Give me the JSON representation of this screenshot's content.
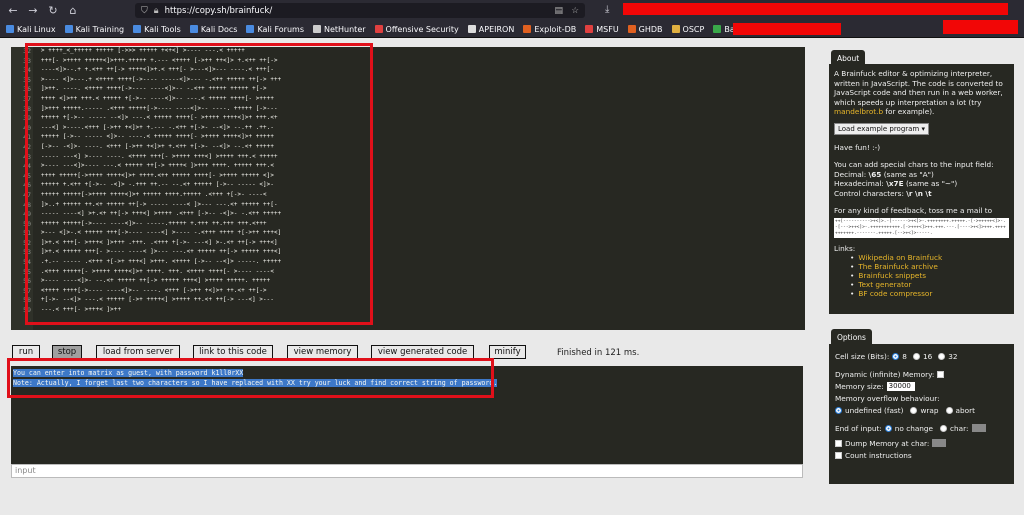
{
  "browser": {
    "url": "https://copy.sh/brainfuck/",
    "bookmarks": [
      "Kali Linux",
      "Kali Training",
      "Kali Tools",
      "Kali Docs",
      "Kali Forums",
      "NetHunter",
      "Offensive Security",
      "APEIRON",
      "Exploit-DB",
      "MSFU",
      "GHDB",
      "OSCP",
      "Base64 Decode and E..."
    ],
    "bookmark_colors": [
      "#4a8be0",
      "#4a8be0",
      "#4a8be0",
      "#4a8be0",
      "#4a8be0",
      "#cccccc",
      "#e04040",
      "#dddddd",
      "#e06020",
      "#e04040",
      "#e06020",
      "#e0b040",
      "#3aa84a"
    ]
  },
  "editor": {
    "line_numbers": [
      "32",
      "33",
      "34",
      "35",
      "36",
      "37",
      "38",
      "39",
      "40",
      "41",
      "42",
      "43",
      "44",
      "45",
      "46",
      "47",
      "48",
      "49",
      "50",
      "51",
      "52",
      "53",
      "54",
      "55",
      "56",
      "57",
      "58",
      "59"
    ],
    "code_lines": [
      "> ++++_<_+++++ +++++ [->>> +++++ +<+<] >---- ---.< +++++",
      "+++[- >++++ +++++<]>+++.+++++ +.--- <++++ [->++ ++<]> +.<++ ++[->",
      "----<]>--.+ +.<++ ++[-> ++++<]>+.< +++[- >---<]>--- ----.< +++[-",
      ">---- <]>---.+ <++++ ++++[->---- -----<]>--- -.<++ +++++ ++[-> +++",
      "]>++. ----. <++++ ++++[->---- ----<]>-- -.<++ +++++ +++++ +[->",
      "++++ <]>++ +++.< +++++ +[->-- ----<]>-- ---.< +++++ ++++[- >++++",
      "]>+++ +++++.----- .<+++ +++++[->---- ----<]>-- ----. +++++ [->---",
      "+++++ +[->-- ----- --<]> ---.< +++++ ++++[- >++++ ++++<]>+ +++.<+",
      "---<] >----.<+++ [->++ +<]>+ +.--- -.<++ +[->- --<]> --.++ .++.-",
      "+++++ [->-- ----- <]>-- ----.< +++++ ++++[- >++++ ++++<]>+ +++++",
      "[->-- -<]>- ----. <+++ [->++ +<]>+ +.<++ +[->- --<]> --.<+ +++++",
      "----- ---<] >---- ----. <++++ +++[- >++++ +++<] >++++ +++.< +++++",
      ">---- ---<]>---- ---.< +++++ ++[-> ++++< ]>+++ ++++. +++++ +++.<",
      "++++ +++++[->++++ ++++<]>+ ++++.<++ +++++ ++++[- >++++ +++++ <]>",
      "+++++ +.<++ +[->-- -<]> -.+++ ++.-- --.<+ +++++ [->-- ----- <]>-",
      "+++++ +++++[->++++ ++++<]>+ +++++ ++++.+++++ .<+++ +[->- ----<",
      "]>..+ +++++ ++.<+ +++++ ++[-> ----- ----< ]>--- ---.<+ +++++ ++[-",
      "----- ----<] >+.<+ ++[-> +++<] >++++ .<+++ [->-- -<]>- -.<++ +++++",
      "+++++ +++++[->---- ----<]>-- -----.+++++ +.+++ ++.+++ +++.<+++",
      ">--- <]>-.< +++++ +++[->---- ----<] >---- -.<+++ ++++ +[->++ +++<]",
      "]>+.< +++[- >+++< ]>+++ .+++. .<+++ +[->- ---<] >-.<+ ++[-> +++<]",
      "]>+.< +++++ +++[- >---- ----< ]>--- ---.<+ +++++ ++[-> +++++ +++<]",
      ".+.-- ----- .<+++ +[->+ +++<] >+++. <++++ [->-- --<]> -----. +++++",
      ".<+++ +++++[- >++++ ++++<]>+ ++++. +++. <++++ ++++[- >---- ----<",
      ">---- ----<]>- --.<+ +++++ ++[-> +++++ +++<] >++++ +++++. +++++",
      "<++++ ++++[->---- ----<]>-- ----. <+++ [->++ +<]>+ ++.<+ ++[->",
      "+[->- --<]> ---.< +++++ [->+ ++++<] >++++ ++.<+ ++[-> ---<] >---",
      "---.< +++[- >+++< ]>++"
    ]
  },
  "toolbar": {
    "run": "run",
    "stop": "stop",
    "load_from_server": "load from server",
    "link_to_code": "link to this code",
    "view_memory": "view memory",
    "view_generated_code": "view generated code",
    "minify": "minify",
    "status": "Finished in 121 ms."
  },
  "output": {
    "line1": "You can enter into matrix as guest, with password k1ll0rXX",
    "line2": "Note: Actually, I forget last two characters so I have replaced with XX try your luck and find correct string of password."
  },
  "input": {
    "placeholder": "input"
  },
  "about": {
    "tab": "About",
    "desc": "A Brainfuck editor & optimizing interpreter, written in JavaScript. The code is converted to JavaScript code and then run in a web worker, which speeds up interpretation a lot (try",
    "desc_link": "mandelbrot.b",
    "desc_tail": " for example).",
    "example_select": "Load example program",
    "have_fun": "Have fun! :-)",
    "special_intro": "You can add special chars to the input field:",
    "decimal_label": "Decimal: ",
    "decimal_value": "\\65",
    "decimal_note": " (same as \"A\")",
    "hex_label": "Hexadecimal: ",
    "hex_value": "\\x7E",
    "hex_note": " (same as \"~\")",
    "control_label": "Control characters: ",
    "control_value": "\\r \\n \\t",
    "feedback": "For any kind of feedback, toss me a mail to",
    "mail_code": "++[---------->+<]>.-[------>+<]>-.++++++++.+++++.-[->+++++<]>-.-[--->++<]>-.+++++++++++.[->+++<]>++.+++.---.[---->+<]>+++.+++++++++++.-------.+++++.[-->+<]>-----.",
    "links_title": "Links:",
    "links": [
      "Wikipedia on Brainfuck",
      "The Brainfuck archive",
      "Brainfuck snippets",
      "Text generator",
      "BF code compressor"
    ]
  },
  "options": {
    "tab": "Options",
    "cell_size_label": "Cell size (Bits):",
    "cell_sizes": [
      "8",
      "16",
      "32"
    ],
    "cell_selected": "8",
    "dynamic_memory": "Dynamic (infinite) Memory:",
    "memory_size_label": "Memory size:",
    "memory_size_value": "30000",
    "overflow_label": "Memory overflow behaviour:",
    "overflow_options": [
      "undefined (fast)",
      "wrap",
      "abort"
    ],
    "overflow_selected": "undefined (fast)",
    "end_of_input_label": "End of input:",
    "eoi_no_change": "no change",
    "eoi_char": "char:",
    "dump_memory": "Dump Memory at char:",
    "count_instructions": "Count instructions"
  },
  "colors": {
    "editor_bg": "#272822",
    "highlight_box": "#e0101a",
    "selection": "#3d78c8",
    "link": "#e6b52a"
  }
}
